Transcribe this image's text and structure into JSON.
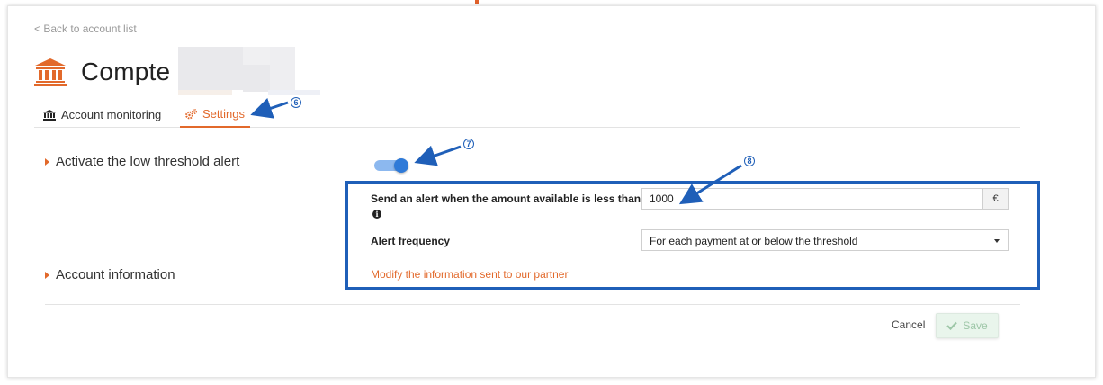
{
  "nav": {
    "back_link": "< Back to account list"
  },
  "header": {
    "title": "Compte"
  },
  "tabs": [
    {
      "label": "Account monitoring",
      "icon": "bank-icon"
    },
    {
      "label": "Settings",
      "icon": "gears-icon",
      "active": true
    }
  ],
  "sections": {
    "low_threshold": {
      "label": "Activate the low threshold alert",
      "toggle_on": true
    },
    "account_info": {
      "label": "Account information"
    }
  },
  "alert_form": {
    "amount_label": "Send an alert when the amount available is less than",
    "amount_value": "1000",
    "currency": "€",
    "frequency_label": "Alert frequency",
    "frequency_selected": "For each payment at or below the threshold",
    "partner_link": "Modify the information sent to our partner"
  },
  "actions": {
    "cancel": "Cancel",
    "save": "Save"
  },
  "annotations": [
    "6",
    "7",
    "8"
  ],
  "colors": {
    "accent": "#e2692b",
    "toggle": "#2f7ad8",
    "annotation": "#1f5fb8",
    "save_disabled": "#e9f5ec"
  }
}
